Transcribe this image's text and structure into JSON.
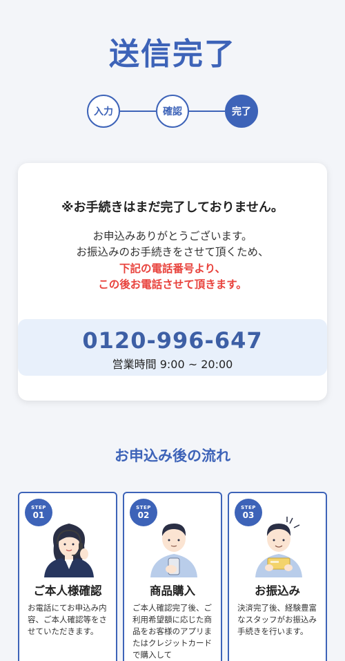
{
  "title": "送信完了",
  "steps": [
    {
      "label": "入力",
      "active": false
    },
    {
      "label": "確認",
      "active": false
    },
    {
      "label": "完了",
      "active": true
    }
  ],
  "card": {
    "notice": "※お手続きはまだ完了しておりません。",
    "message_lines": [
      "お申込みありがとうございます。",
      "お振込みのお手続きをさせて頂くため、"
    ],
    "highlight_lines": [
      "下記の電話番号より、",
      "この後お電話させて頂きます。"
    ],
    "phone": "0120-996-647",
    "hours": "営業時間 9:00 ~ 20:00"
  },
  "flow": {
    "title": "お申込み後の流れ",
    "step_label": "STEP",
    "items": [
      {
        "num": "01",
        "heading": "ご本人様確認",
        "desc": "お電話にてお申込み内容、ご本人確認等をさせていただきます。"
      },
      {
        "num": "02",
        "heading": "商品購入",
        "desc": "ご本人確認完了後、ご利用希望額に応じた商品をお客様のアプリまたはクレジットカードで購入して"
      },
      {
        "num": "03",
        "heading": "お振込み",
        "desc": "決済完了後、経験豊富なスタッフがお振込み手続きを行います。"
      }
    ]
  },
  "colors": {
    "accent": "#3d63b8",
    "highlight": "#e8423c",
    "phone_bg": "#e8f0fb"
  }
}
